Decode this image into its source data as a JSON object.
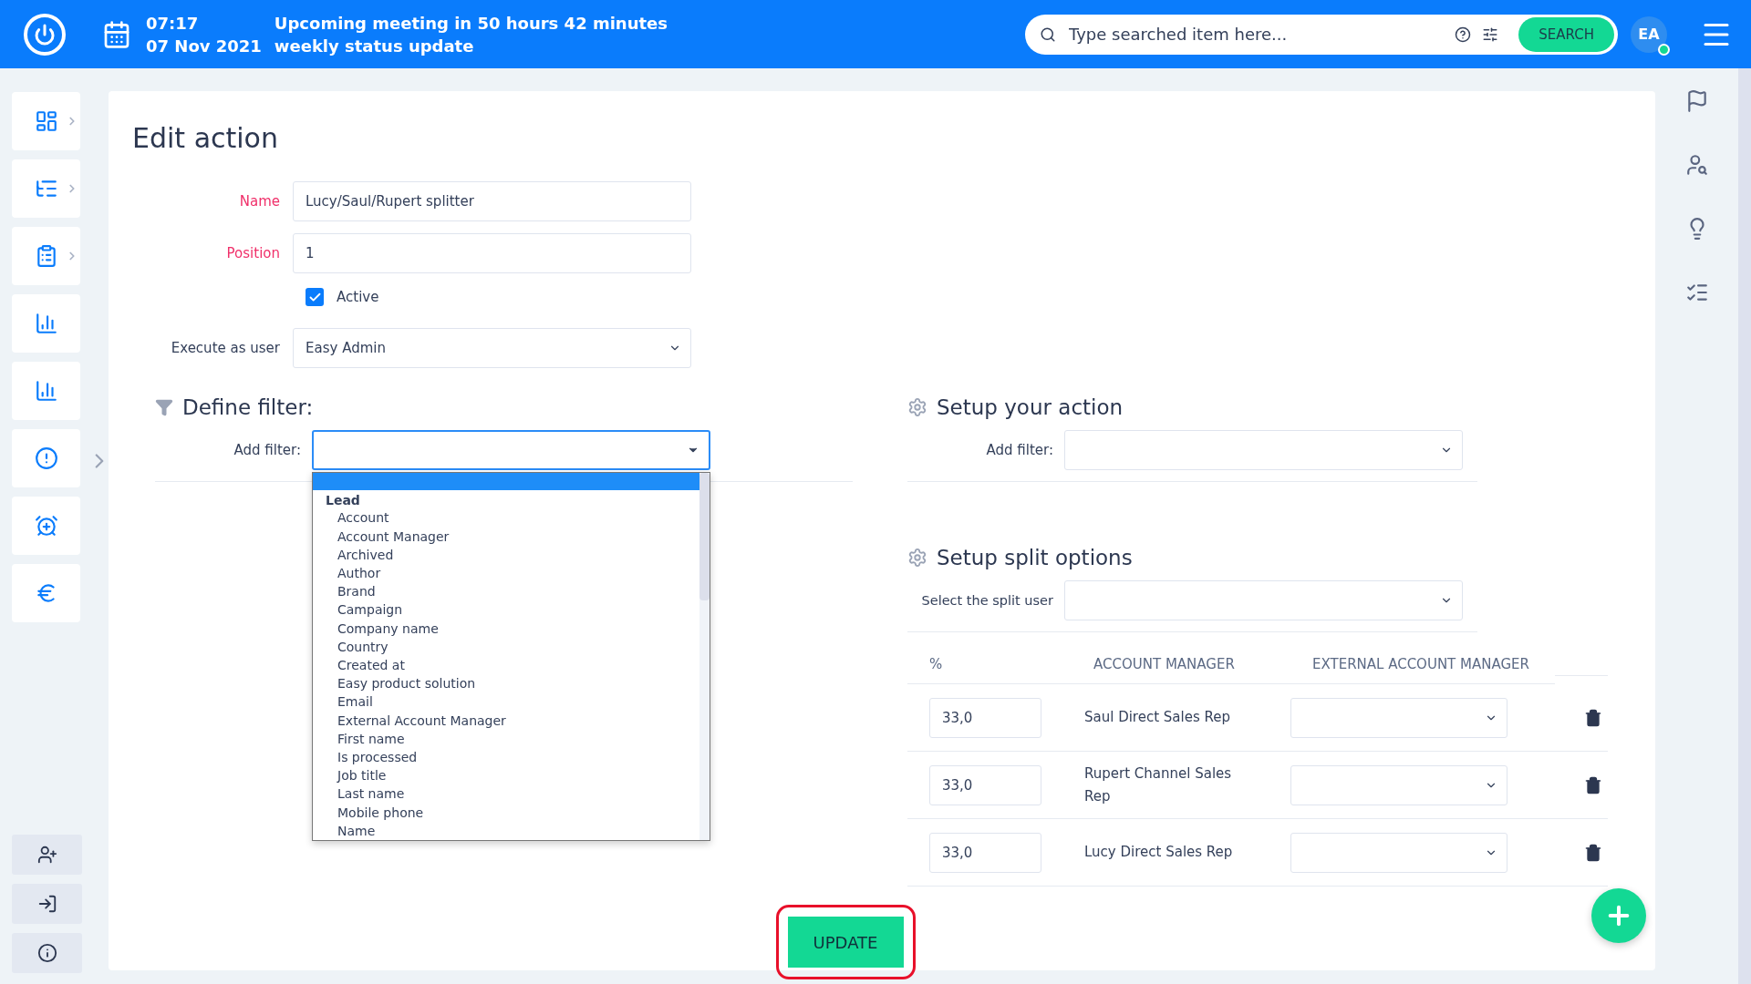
{
  "header": {
    "time": "07:17",
    "meeting": "Upcoming meeting in 50 hours 42 minutes",
    "date": "07 Nov 2021",
    "subject": "weekly status update",
    "search": {
      "placeholder": "Type searched item here..."
    },
    "search_button": "SEARCH",
    "avatar": {
      "initials": "EA",
      "online": true
    }
  },
  "sidebar": {
    "items": [
      {
        "kind": "dashboard",
        "expandable": true
      },
      {
        "kind": "tree",
        "expandable": true
      },
      {
        "kind": "clipboard",
        "expandable": true
      },
      {
        "kind": "bars",
        "expandable": false
      },
      {
        "kind": "chart",
        "expandable": false
      },
      {
        "kind": "alert",
        "expandable": false
      },
      {
        "kind": "alarm",
        "expandable": false
      },
      {
        "kind": "euro",
        "expandable": false
      }
    ],
    "bottom": [
      {
        "kind": "add-user"
      },
      {
        "kind": "sign-in"
      },
      {
        "kind": "info"
      }
    ]
  },
  "right_bar": [
    {
      "kind": "flag"
    },
    {
      "kind": "user-search"
    },
    {
      "kind": "bulb"
    },
    {
      "kind": "checklist"
    }
  ],
  "page": {
    "title": "Edit action",
    "fields": [
      {
        "kind": "text",
        "label": "Name",
        "required": true,
        "value": "Lucy/Saul/Rupert splitter"
      },
      {
        "kind": "text",
        "label": "Position",
        "required": true,
        "value": "1"
      },
      {
        "kind": "checkbox",
        "label": "Active",
        "checked": true
      },
      {
        "kind": "select",
        "label": "Execute as user",
        "required": false,
        "value": "Easy Admin"
      }
    ],
    "filter": {
      "title": "Define filter:",
      "add_label": "Add filter:",
      "dropdown": {
        "open": true,
        "group": "Lead",
        "options": [
          "Account",
          "Account Manager",
          "Archived",
          "Author",
          "Brand",
          "Campaign",
          "Company name",
          "Country",
          "Created at",
          "Easy product solution",
          "Email",
          "External Account Manager",
          "First name",
          "Is processed",
          "Job title",
          "Last name",
          "Mobile phone",
          "Name"
        ]
      }
    },
    "action": {
      "title": "Setup your action",
      "add_label": "Add filter:"
    },
    "split": {
      "title": "Setup split options",
      "user_label": "Select the split user",
      "columns": [
        "%",
        "ACCOUNT MANAGER",
        "EXTERNAL ACCOUNT MANAGER"
      ],
      "rows": [
        {
          "percent": "33,0",
          "manager": "Saul Direct Sales Rep"
        },
        {
          "percent": "33,0",
          "manager": "Rupert Channel Sales Rep"
        },
        {
          "percent": "33,0",
          "manager": "Lucy Direct Sales Rep"
        }
      ]
    },
    "update_button": "UPDATE",
    "update_highlighted": true
  }
}
